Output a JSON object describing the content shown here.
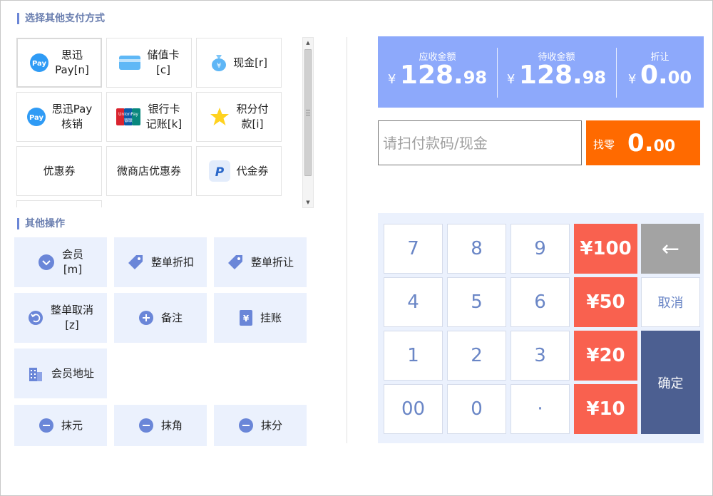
{
  "payment": {
    "title": "选择其他支付方式",
    "methods": [
      {
        "label": "思迅\nPay[n]",
        "icon": "pay-icon"
      },
      {
        "label": "储值卡\n[c]",
        "icon": "card-icon"
      },
      {
        "label": "现金[r]",
        "icon": "money-bag-icon"
      },
      {
        "label": "思迅Pay\n核销",
        "icon": "pay-icon"
      },
      {
        "label": "银行卡\n记账[k]",
        "icon": "unionpay-icon"
      },
      {
        "label": "积分付\n款[i]",
        "icon": "star-icon"
      },
      {
        "label": "优惠券",
        "icon": ""
      },
      {
        "label": "微商店优惠券",
        "icon": ""
      },
      {
        "label": "代金券",
        "icon": "paypal-icon"
      }
    ],
    "pay_badge": "Pay",
    "unionpay_top": "UnionPay",
    "unionpay_bottom": "银联"
  },
  "operations": {
    "title": "其他操作",
    "items": [
      {
        "label": "会员\n[m]",
        "icon": "member-icon"
      },
      {
        "label": "整单折扣",
        "icon": "tag-icon"
      },
      {
        "label": "整单折让",
        "icon": "tag-icon"
      },
      {
        "label": "整单取消\n[z]",
        "icon": "undo-icon"
      },
      {
        "label": "备注",
        "icon": "plus-circle-icon"
      },
      {
        "label": "挂账",
        "icon": "yen-bill-icon"
      },
      {
        "label": "会员地址",
        "icon": "building-icon"
      },
      {
        "label": "抹元",
        "icon": "minus-circle-icon"
      },
      {
        "label": "抹角",
        "icon": "minus-circle-icon"
      },
      {
        "label": "抹分",
        "icon": "minus-circle-icon"
      }
    ]
  },
  "summary": {
    "currency": "¥",
    "receivable": {
      "label": "应收金额",
      "int": "128.",
      "dec": "98"
    },
    "pending": {
      "label": "待收金额",
      "int": "128.",
      "dec": "98"
    },
    "discount": {
      "label": "折让",
      "int": "0.",
      "dec": "00"
    }
  },
  "scan": {
    "placeholder": "请扫付款码/现金",
    "value": ""
  },
  "change": {
    "label": "找零",
    "int": "0.",
    "dec": "00"
  },
  "keypad": {
    "digits": [
      "7",
      "8",
      "9",
      "4",
      "5",
      "6",
      "1",
      "2",
      "3",
      "00",
      "0",
      "·"
    ],
    "money": [
      "¥100",
      "¥50",
      "¥20",
      "¥10"
    ],
    "backspace": "←",
    "cancel": "取消",
    "confirm": "确定"
  },
  "colors": {
    "accent": "#8da9fb",
    "orange": "#ff6a00",
    "money_red": "#f9614f",
    "confirm": "#4c5f91",
    "tile_bg": "#ebf1fd",
    "icon_blue": "#6a86d8"
  }
}
